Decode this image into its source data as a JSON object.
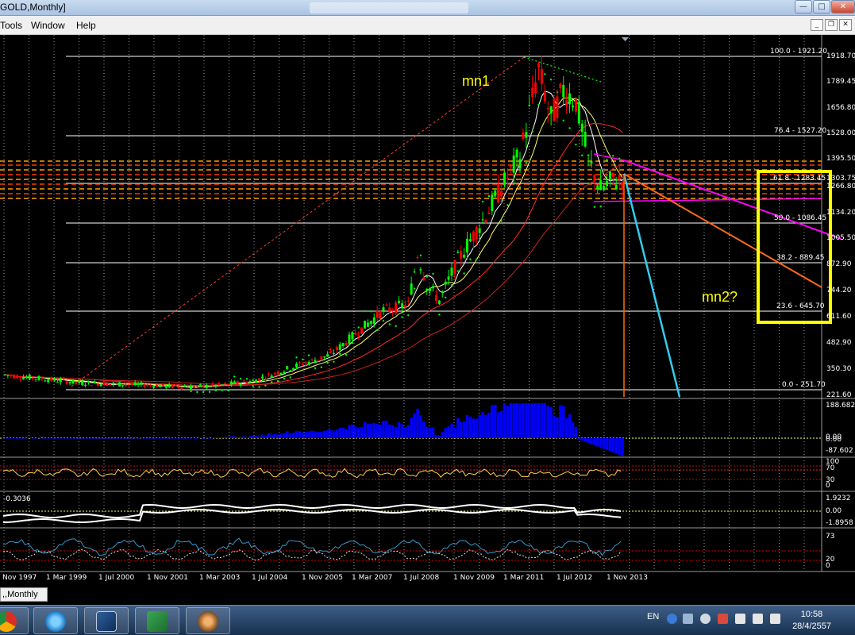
{
  "window": {
    "title": "GOLD,Monthly]"
  },
  "menu": {
    "items": [
      "Tools",
      "Window",
      "Help"
    ]
  },
  "annotations": {
    "mn1": "mn1",
    "mn2": "mn2?"
  },
  "fib_levels": [
    {
      "label": "100.0 - 1921.20",
      "price": 1921.2
    },
    {
      "label": "76.4 - 1527.20",
      "price": 1527.2
    },
    {
      "label": "61.8 - 1283.45",
      "price": 1283.45
    },
    {
      "label": "50.0 - 1086.45",
      "price": 1086.45
    },
    {
      "label": "38.2 - 889.45",
      "price": 889.45
    },
    {
      "label": "23.6 - 645.70",
      "price": 645.7
    },
    {
      "label": "0.0 - 251.70",
      "price": 251.7
    }
  ],
  "price_axis": [
    "1918.70",
    "1789.45",
    "1656.80",
    "1528.00",
    "1395.50",
    "1303.75",
    "1266.80",
    "1134.20",
    "1005.50",
    "872.90",
    "744.20",
    "611.60",
    "482.90",
    "350.30",
    "221.60"
  ],
  "date_axis": [
    "Nov 1997",
    "1 Mar 1999",
    "1 Jul 2000",
    "1 Nov 2001",
    "1 Mar 2003",
    "1 Jul 2004",
    "1 Nov 2005",
    "1 Mar 2007",
    "1 Jul 2008",
    "1 Nov 2009",
    "1 Mar 2011",
    "1 Jul 2012",
    "1 Nov 2013"
  ],
  "macd": {
    "high": "188.682",
    "zero_a": "0.00",
    "zero_b": "0.00",
    "low": "-87.602"
  },
  "rsi": {
    "l100": "100",
    "l70": "70",
    "l30": "30",
    "l0": "0"
  },
  "osc": {
    "left_value": "-0.3036",
    "high": "1.9232",
    "zero": "0.00",
    "low": "-1.8958"
  },
  "stoch": {
    "l73": "73",
    "l20": "20",
    "l0": "0"
  },
  "chart_tab": ",,Monthly",
  "tray": {
    "lang": "EN",
    "time": "10:58",
    "date": "28/4/2557"
  },
  "colors": {
    "bull": "#00ff00",
    "bear": "#ff0000",
    "fib": "#ffffff",
    "magenta": "#ff00ff",
    "orange": "#ff6a1a",
    "cyan": "#33ccee",
    "yellow": "#ffff00",
    "macd_bar": "#0000ff"
  }
}
